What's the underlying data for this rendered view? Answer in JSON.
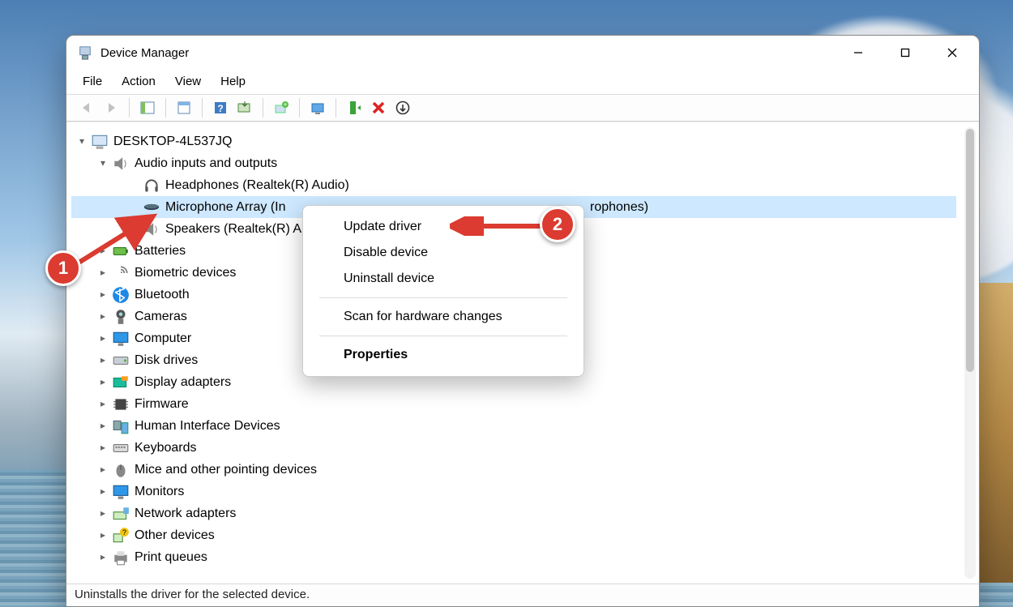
{
  "window": {
    "title": "Device Manager"
  },
  "menus": {
    "file": "File",
    "action": "Action",
    "view": "View",
    "help": "Help"
  },
  "root": {
    "name": "DESKTOP-4L537JQ"
  },
  "categories": {
    "audio": {
      "label": "Audio inputs and outputs",
      "children": {
        "headphones": "Headphones (Realtek(R) Audio)",
        "mic_visible_prefix": "Microphone Array (In",
        "mic_visible_suffix": "rophones)",
        "speakers_visible": "Speakers (Realtek(R) A"
      }
    },
    "batteries": "Batteries",
    "biometric": "Biometric devices",
    "bluetooth": "Bluetooth",
    "cameras": "Cameras",
    "computer": "Computer",
    "disk": "Disk drives",
    "display": "Display adapters",
    "firmware": "Firmware",
    "hid": "Human Interface Devices",
    "keyboards": "Keyboards",
    "mice": "Mice and other pointing devices",
    "monitors": "Monitors",
    "network": "Network adapters",
    "other": "Other devices",
    "print": "Print queues"
  },
  "context_menu": {
    "update": "Update driver",
    "disable": "Disable device",
    "uninstall": "Uninstall device",
    "scan": "Scan for hardware changes",
    "properties": "Properties"
  },
  "status": "Uninstalls the driver for the selected device.",
  "annotations": {
    "step1": "1",
    "step2": "2"
  }
}
